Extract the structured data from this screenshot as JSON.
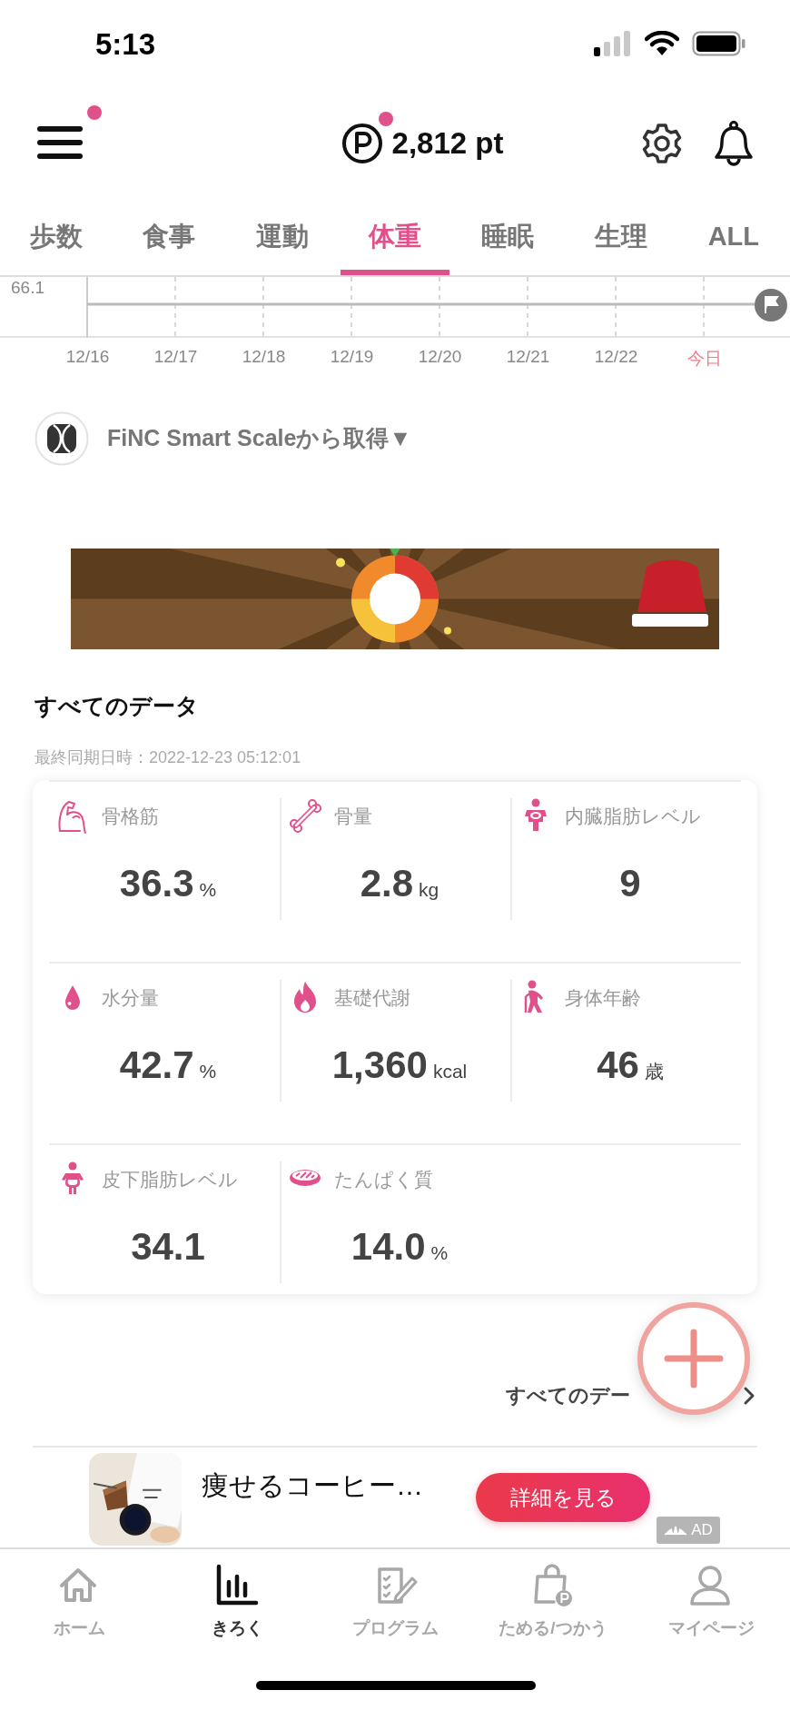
{
  "status_bar": {
    "time": "5:13"
  },
  "header": {
    "menu_badge": true,
    "points": "2,812 pt",
    "points_badge": true
  },
  "tabs": [
    {
      "label": "歩数",
      "selected": false
    },
    {
      "label": "食事",
      "selected": false
    },
    {
      "label": "運動",
      "selected": false
    },
    {
      "label": "体重",
      "selected": true
    },
    {
      "label": "睡眠",
      "selected": false
    },
    {
      "label": "生理",
      "selected": false
    },
    {
      "label": "ALL",
      "selected": false
    }
  ],
  "chart": {
    "y_tick": "66.1",
    "dates": [
      {
        "label": "12/16",
        "today": false
      },
      {
        "label": "12/17",
        "today": false
      },
      {
        "label": "12/18",
        "today": false
      },
      {
        "label": "12/19",
        "today": false
      },
      {
        "label": "12/20",
        "today": false
      },
      {
        "label": "12/21",
        "today": false
      },
      {
        "label": "12/22",
        "today": false
      },
      {
        "label": "今日",
        "today": true
      }
    ]
  },
  "source": {
    "text": "FiNC Smart Scaleから取得▼"
  },
  "section": {
    "title": "すべてのデータ",
    "sync": "最終同期日時：2022-12-23 05:12:01"
  },
  "metrics": [
    {
      "label": "骨格筋",
      "value": "36.3",
      "unit": "%"
    },
    {
      "label": "骨量",
      "value": "2.8",
      "unit": "kg"
    },
    {
      "label": "内臓脂肪レベル",
      "value": "9"
    },
    {
      "label": "水分量",
      "value": "42.7",
      "unit": "%"
    },
    {
      "label": "基礎代謝",
      "value": "1,360",
      "unit": "kcal"
    },
    {
      "label": "身体年齢",
      "value": "46",
      "unit": "歳"
    },
    {
      "label": "皮下脂肪レベル",
      "value": "34.1"
    },
    {
      "label": "たんぱく質",
      "value": "14.0",
      "unit": "%"
    }
  ],
  "all_data_link": {
    "label": "すべてのデー"
  },
  "ad": {
    "title": "痩せるコーヒー…",
    "button": "詳細を見る",
    "badge": "AD"
  },
  "nav": [
    {
      "label": "ホーム",
      "selected": false
    },
    {
      "label": "きろく",
      "selected": true
    },
    {
      "label": "プログラム",
      "selected": false
    },
    {
      "label": "ためる/つかう",
      "selected": false
    },
    {
      "label": "マイページ",
      "selected": false
    }
  ]
}
